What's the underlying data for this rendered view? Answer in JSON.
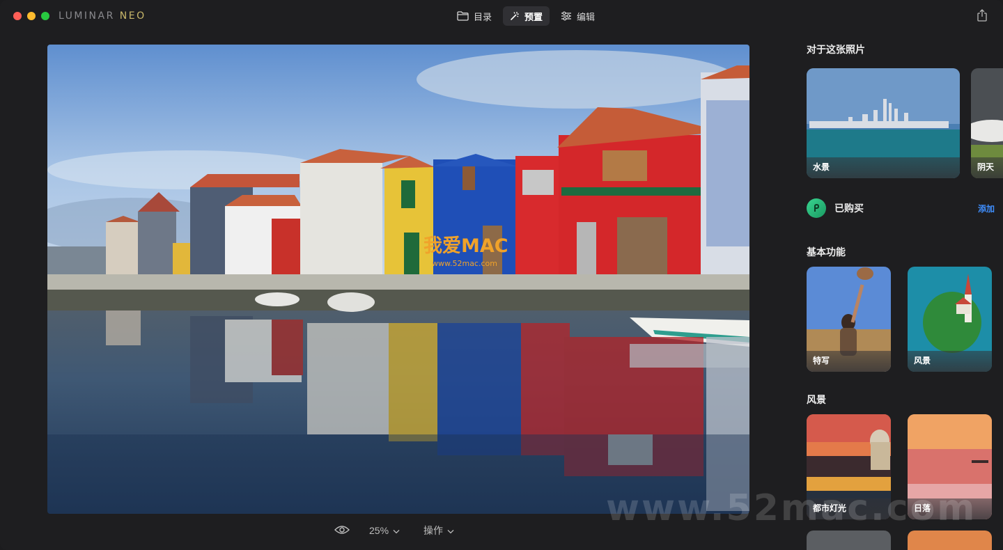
{
  "app": {
    "brand_part1": "LUMINAR ",
    "brand_part2": "NEO"
  },
  "nav": {
    "catalog": "目录",
    "presets": "预置",
    "edit": "编辑",
    "active": "presets"
  },
  "bottom_bar": {
    "zoom": "25%",
    "actions": "操作"
  },
  "panel": {
    "about_title": "对于这张照片",
    "about_cards": [
      {
        "label": "水景"
      },
      {
        "label": "阴天"
      }
    ],
    "purchased": {
      "label": "已购买",
      "add": "添加"
    },
    "basic_title": "基本功能",
    "basic_cards": [
      {
        "label": "特写"
      },
      {
        "label": "风景"
      }
    ],
    "landscape_title": "风景",
    "landscape_cards": [
      {
        "label": "都市灯光"
      },
      {
        "label": "日落"
      }
    ]
  },
  "watermarks": {
    "center_cn": "我爱MAC",
    "center_url": "www.52mac.com",
    "corner": "www.52mac.com"
  },
  "colors": {
    "accent_link": "#3f8efc",
    "purchased_icon": "#2fbf7e",
    "active_nav_bg": "#303034"
  },
  "icons": {
    "catalog": "folder-icon",
    "presets": "magic-wand-icon",
    "edit": "sliders-icon",
    "share": "share-icon",
    "preview": "eye-icon"
  }
}
